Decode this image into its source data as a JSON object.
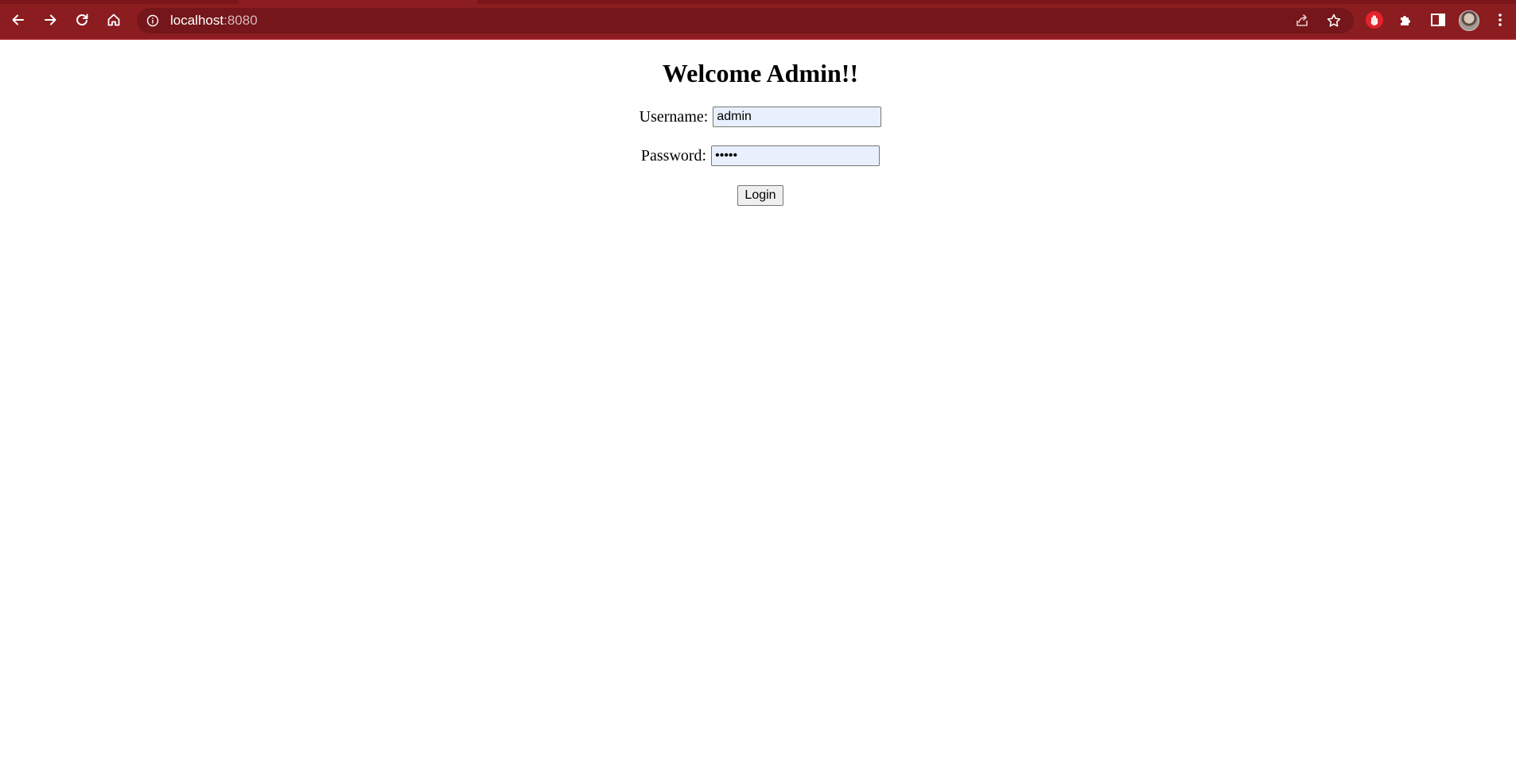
{
  "browser": {
    "url_host": "localhost",
    "url_port": ":8080",
    "theme_color": "#8b1c20",
    "icons": {
      "back": "arrow-left-icon",
      "forward": "arrow-right-icon",
      "reload": "reload-icon",
      "home": "home-icon",
      "site_info": "info-icon",
      "share": "share-icon",
      "bookmark": "star-icon",
      "extension_red": "hand-stop-extension-icon",
      "extensions": "puzzle-icon",
      "side_panel": "side-panel-icon",
      "menu": "kebab-menu-icon"
    }
  },
  "page": {
    "title": "Welcome Admin!!",
    "username_label": "Username:",
    "username_value": "admin",
    "password_label": "Password:",
    "password_value": "admin",
    "login_label": "Login",
    "input_autofill_color": "#e8f0fe"
  }
}
